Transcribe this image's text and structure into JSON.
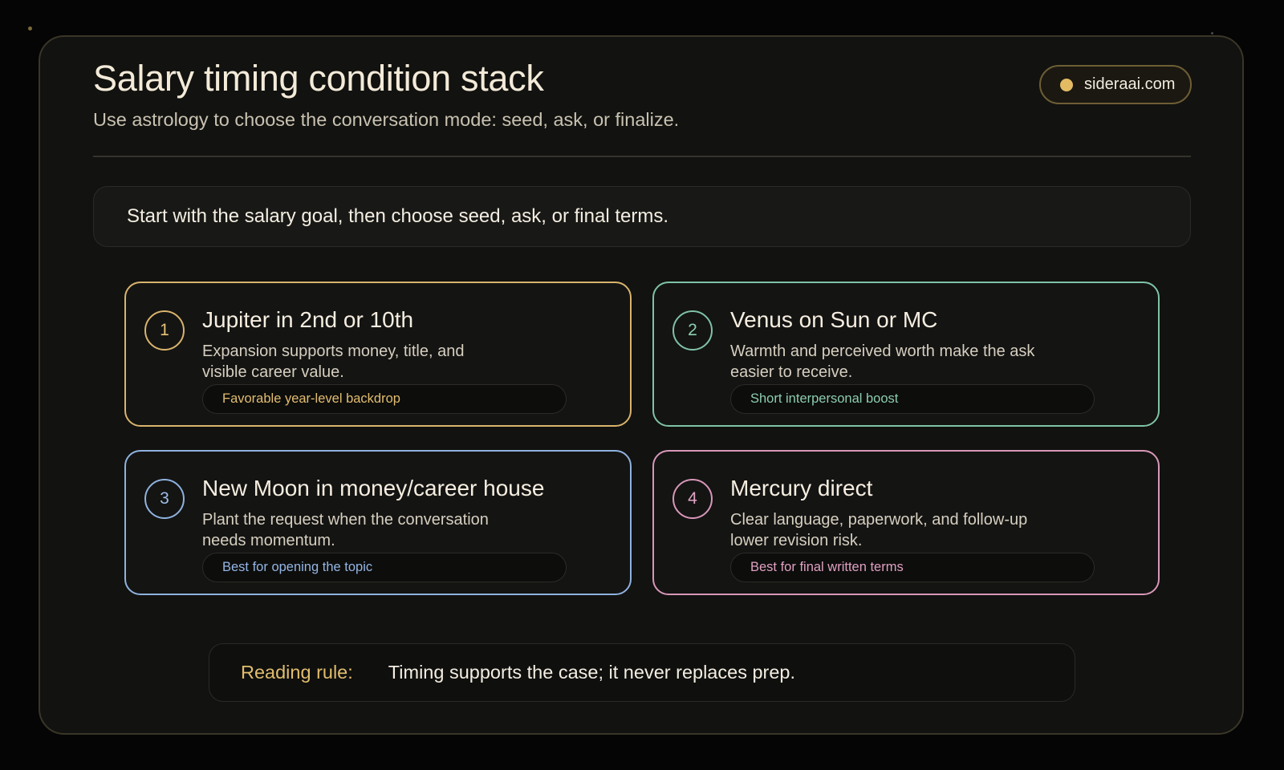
{
  "header": {
    "title": "Salary timing condition stack",
    "subtitle": "Use astrology to choose the conversation mode: seed, ask, or finalize.",
    "site": "sideraai.com"
  },
  "intro": "Start with the salary goal, then choose seed, ask, or final terms.",
  "conditions": [
    {
      "number": "1",
      "title": "Jupiter in 2nd or 10th",
      "description": "Expansion supports money, title, and visible career value.",
      "tag": "Favorable year-level backdrop",
      "color": "#d9b46c"
    },
    {
      "number": "2",
      "title": "Venus on Sun or MC",
      "description": "Warmth and perceived worth make the ask easier to receive.",
      "tag": "Short interpersonal boost",
      "color": "#7fc3a6"
    },
    {
      "number": "3",
      "title": "New Moon in money/career house",
      "description": "Plant the request when the conversation needs momentum.",
      "tag": "Best for opening the topic",
      "color": "#8fb2df"
    },
    {
      "number": "4",
      "title": "Mercury direct",
      "description": "Clear language, paperwork, and follow-up lower revision risk.",
      "tag": "Best for final written terms",
      "color": "#d897b8"
    }
  ],
  "rule": {
    "label": "Reading rule:",
    "text": "Timing supports the case; it never replaces prep."
  }
}
